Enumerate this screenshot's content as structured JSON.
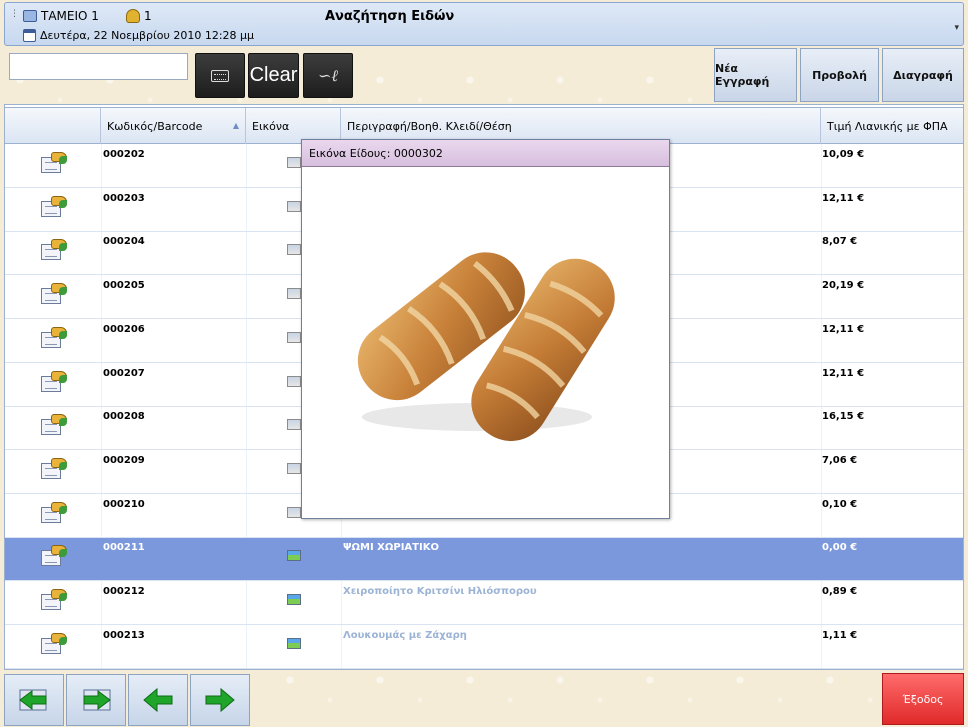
{
  "header": {
    "till_label": "ΤΑΜΕΙΟ 1",
    "user_count": "1",
    "date_text": "Δευτέρα, 22 Νοεμβρίου 2010 12:28 μμ",
    "screen_title": "Αναζήτηση Ειδών"
  },
  "toolbar": {
    "search_value": "",
    "clear_label": "Clear",
    "new_label": "Νέα Εγγραφή",
    "view_label": "Προβολή",
    "delete_label": "Διαγραφή"
  },
  "table": {
    "columns": {
      "code": "Κωδικός/Barcode",
      "image": "Εικόνα",
      "description": "Περιγραφή/Βοηθ. Κλειδί/Θέση",
      "price": "Τιμή Λιανικής με ΦΠΑ"
    },
    "rows": [
      {
        "code": "000202",
        "description": "",
        "price": "10,09 €"
      },
      {
        "code": "000203",
        "description": "",
        "price": "12,11 €"
      },
      {
        "code": "000204",
        "description": "",
        "price": "8,07 €"
      },
      {
        "code": "000205",
        "description": "",
        "price": "20,19 €"
      },
      {
        "code": "000206",
        "description": "",
        "price": "12,11 €"
      },
      {
        "code": "000207",
        "description": "",
        "price": "12,11 €"
      },
      {
        "code": "000208",
        "description": "",
        "price": "16,15 €"
      },
      {
        "code": "000209",
        "description": "",
        "price": "7,06 €"
      },
      {
        "code": "000210",
        "description": "",
        "price": "0,10 €"
      },
      {
        "code": "000211",
        "description": "ΨΩΜΙ ΧΩΡΙΑΤΙΚΟ",
        "price": "0,00 €"
      },
      {
        "code": "000212",
        "description": "Χειροποίητο Κριτσίνι Ηλιόσπορου",
        "price": "0,89 €"
      },
      {
        "code": "000213",
        "description": "Λουκουμάς με Ζάχαρη",
        "price": "1,11 €"
      }
    ]
  },
  "popup": {
    "title": "Εικόνα Είδους: 0000302"
  },
  "footer": {
    "exit_label": "Έξοδος"
  },
  "colors": {
    "selected_row": "#7c98dd",
    "exit": "#e02a2a",
    "nav_arrow": "#1fa52a"
  }
}
